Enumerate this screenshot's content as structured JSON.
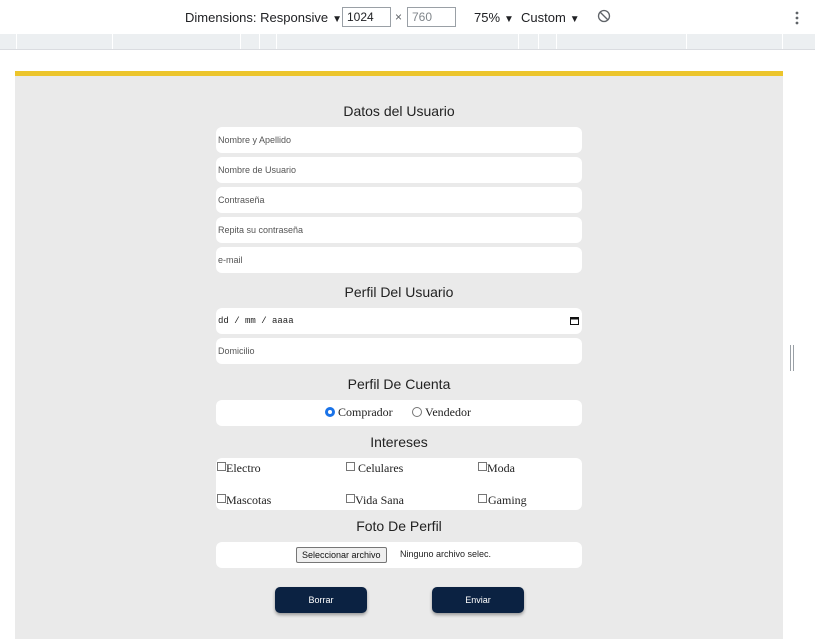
{
  "devtools": {
    "dimensions_label": "Dimensions: Responsive",
    "width_value": "1024",
    "times": "×",
    "height_value": "760",
    "zoom": "75%",
    "throttle": "Custom",
    "caret": "▼",
    "icons": [
      "rotate-icon",
      "more-icon"
    ]
  },
  "form": {
    "sections": {
      "user": "Datos del Usuario",
      "profile": "Perfil Del Usuario",
      "account": "Perfil De Cuenta",
      "interests": "Intereses",
      "photo": "Foto De Perfil"
    },
    "fields": {
      "name": "Nombre y Apellido",
      "username": "Nombre de Usuario",
      "password": "Contraseña",
      "password_repeat": "Repita su contraseña",
      "email": "e-mail",
      "date": "dd / mm / aaaa",
      "address": "Domicilio"
    },
    "account_options": [
      {
        "label": "Comprador",
        "selected": true
      },
      {
        "label": "Vendedor",
        "selected": false
      }
    ],
    "interests": [
      "Electro",
      "Celulares",
      "Moda",
      "Mascotas",
      "Vida Sana",
      "Gaming"
    ],
    "file": {
      "button": "Seleccionar archivo",
      "status": "Ninguno archivo selec."
    },
    "buttons": {
      "reset": "Borrar",
      "submit": "Enviar"
    }
  },
  "colors": {
    "accent": "#ecc52c",
    "page_bg": "#eaeaea",
    "button_bg": "#0b2242",
    "radio_selected": "#1a73e8"
  }
}
